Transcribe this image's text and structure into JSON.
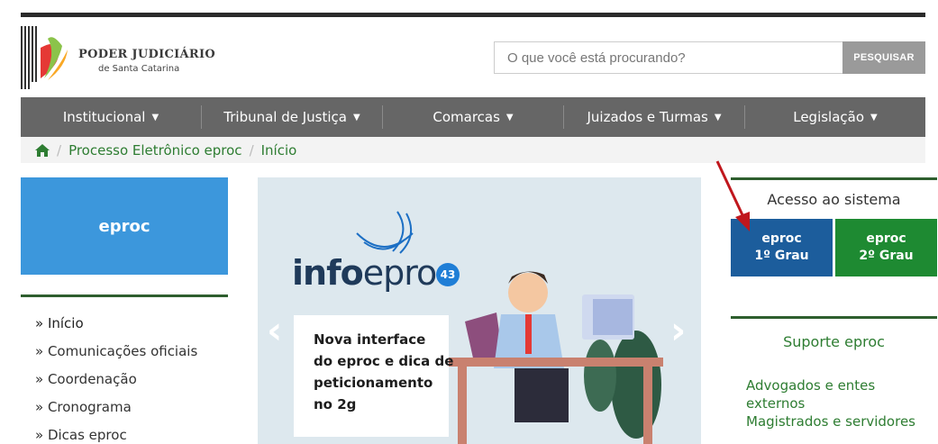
{
  "header": {
    "logo_title": "PODER JUDICIÁRIO",
    "logo_subtitle": "de Santa Catarina",
    "search_placeholder": "O que você está procurando?",
    "search_button": "PESQUISAR"
  },
  "nav": {
    "items": [
      {
        "label": "Institucional",
        "icon": "caret-down-icon"
      },
      {
        "label": "Tribunal de Justiça",
        "icon": "caret-down-icon"
      },
      {
        "label": "Comarcas",
        "icon": "caret-down-icon"
      },
      {
        "label": "Juizados e Turmas",
        "icon": "caret-down-icon"
      },
      {
        "label": "Legislação",
        "icon": "caret-down-icon"
      }
    ]
  },
  "breadcrumb": {
    "home_icon": "home-icon",
    "items": [
      "Processo Eletrônico eproc",
      "Início"
    ]
  },
  "sidebar": {
    "title": "eproc",
    "items": [
      "» Início",
      "» Comunicações oficiais",
      "» Coordenação",
      "» Cronograma",
      "» Dicas eproc"
    ]
  },
  "banner": {
    "logo_bold": "info",
    "logo_light": "eproc",
    "badge": "43",
    "lines": [
      "Nova interface",
      "do eproc e dica de",
      "peticionamento",
      "no 2g"
    ]
  },
  "acesso": {
    "title": "Acesso ao sistema",
    "btn1_line1": "eproc",
    "btn1_line2": "1º Grau",
    "btn2_line1": "eproc",
    "btn2_line2": "2º Grau"
  },
  "suporte": {
    "title": "Suporte eproc",
    "links": [
      "Advogados e entes",
      "externos",
      "Magistrados e servidores"
    ]
  },
  "colors": {
    "nav_bg": "#666666",
    "eproc_blue": "#3c97dc",
    "btn_1grau": "#1c5d9c",
    "btn_2grau": "#1e8a32",
    "link_green": "#2e7d32",
    "annotation_arrow": "#c0171d"
  }
}
